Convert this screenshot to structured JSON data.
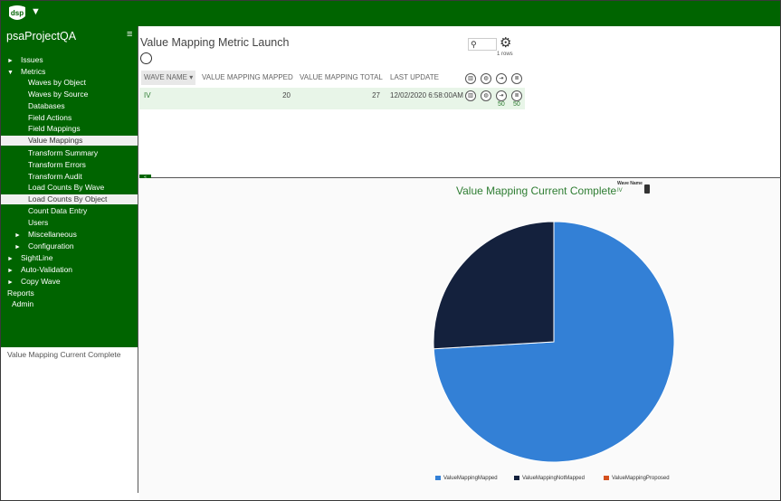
{
  "app": {
    "logo_text": "dsp",
    "project_title": "psaProjectQA",
    "colors": {
      "brand_green": "#006400",
      "chart_green": "#2e7d32",
      "row_bg": "#e8f5e8"
    }
  },
  "sidebar": {
    "items": [
      {
        "label": "Issues",
        "arrow": "►",
        "indent": 0
      },
      {
        "label": "Metrics",
        "arrow": "▼",
        "indent": 0
      },
      {
        "label": "Waves by Object",
        "indent": 2
      },
      {
        "label": "Waves by Source",
        "indent": 2
      },
      {
        "label": "Databases",
        "indent": 2
      },
      {
        "label": "Field Actions",
        "indent": 2
      },
      {
        "label": "Field Mappings",
        "indent": 2
      },
      {
        "label": "Value Mappings",
        "indent": 2,
        "active": true
      },
      {
        "label": "Transform Summary",
        "indent": 2
      },
      {
        "label": "Transform Errors",
        "indent": 2
      },
      {
        "label": "Transform Audit",
        "indent": 2
      },
      {
        "label": "Load Counts By Wave",
        "indent": 2
      },
      {
        "label": "Load Counts By Object",
        "indent": 2,
        "active": true
      },
      {
        "label": "Count Data Entry",
        "indent": 2
      },
      {
        "label": "Users",
        "indent": 2
      },
      {
        "label": "Miscellaneous",
        "arrow": "►",
        "indent": 1
      },
      {
        "label": "Configuration",
        "arrow": "►",
        "indent": 1
      },
      {
        "label": "SightLine",
        "arrow": "►",
        "indent": 0
      },
      {
        "label": "Auto-Validation",
        "arrow": "►",
        "indent": 0
      },
      {
        "label": "Copy Wave",
        "arrow": "►",
        "indent": 0
      },
      {
        "label": "Reports",
        "indent": 0
      },
      {
        "label": "Admin",
        "indent": -1
      }
    ],
    "footer_label": "Value Mapping Current Complete"
  },
  "main": {
    "title": "Value Mapping Metric Launch",
    "rows_count": "1 rows",
    "grid": {
      "headers": [
        "WAVE NAME ▾",
        "VALUE MAPPING MAPPED",
        "VALUE MAPPING TOTAL",
        "LAST UPDATE"
      ],
      "rows": [
        {
          "wave_name": "IV",
          "mapped": "20",
          "total": "27",
          "last_update": "12/02/2020 6:58:00AM",
          "count_a": "50",
          "count_b": "50"
        }
      ]
    }
  },
  "chart_panel": {
    "wave_name_label": "Wave Name",
    "wave_name_value": "IV"
  },
  "chart_data": {
    "type": "pie",
    "title": "Value Mapping Current Complete",
    "slices": [
      {
        "name": "ValueMappingMapped",
        "value": 20,
        "color": "#3380d6"
      },
      {
        "name": "ValueMappingNotMapped",
        "value": 7,
        "color": "#14213d"
      },
      {
        "name": "ValueMappingProposed",
        "value": 0,
        "color": "#d4501e"
      }
    ],
    "legend_position": "bottom"
  }
}
